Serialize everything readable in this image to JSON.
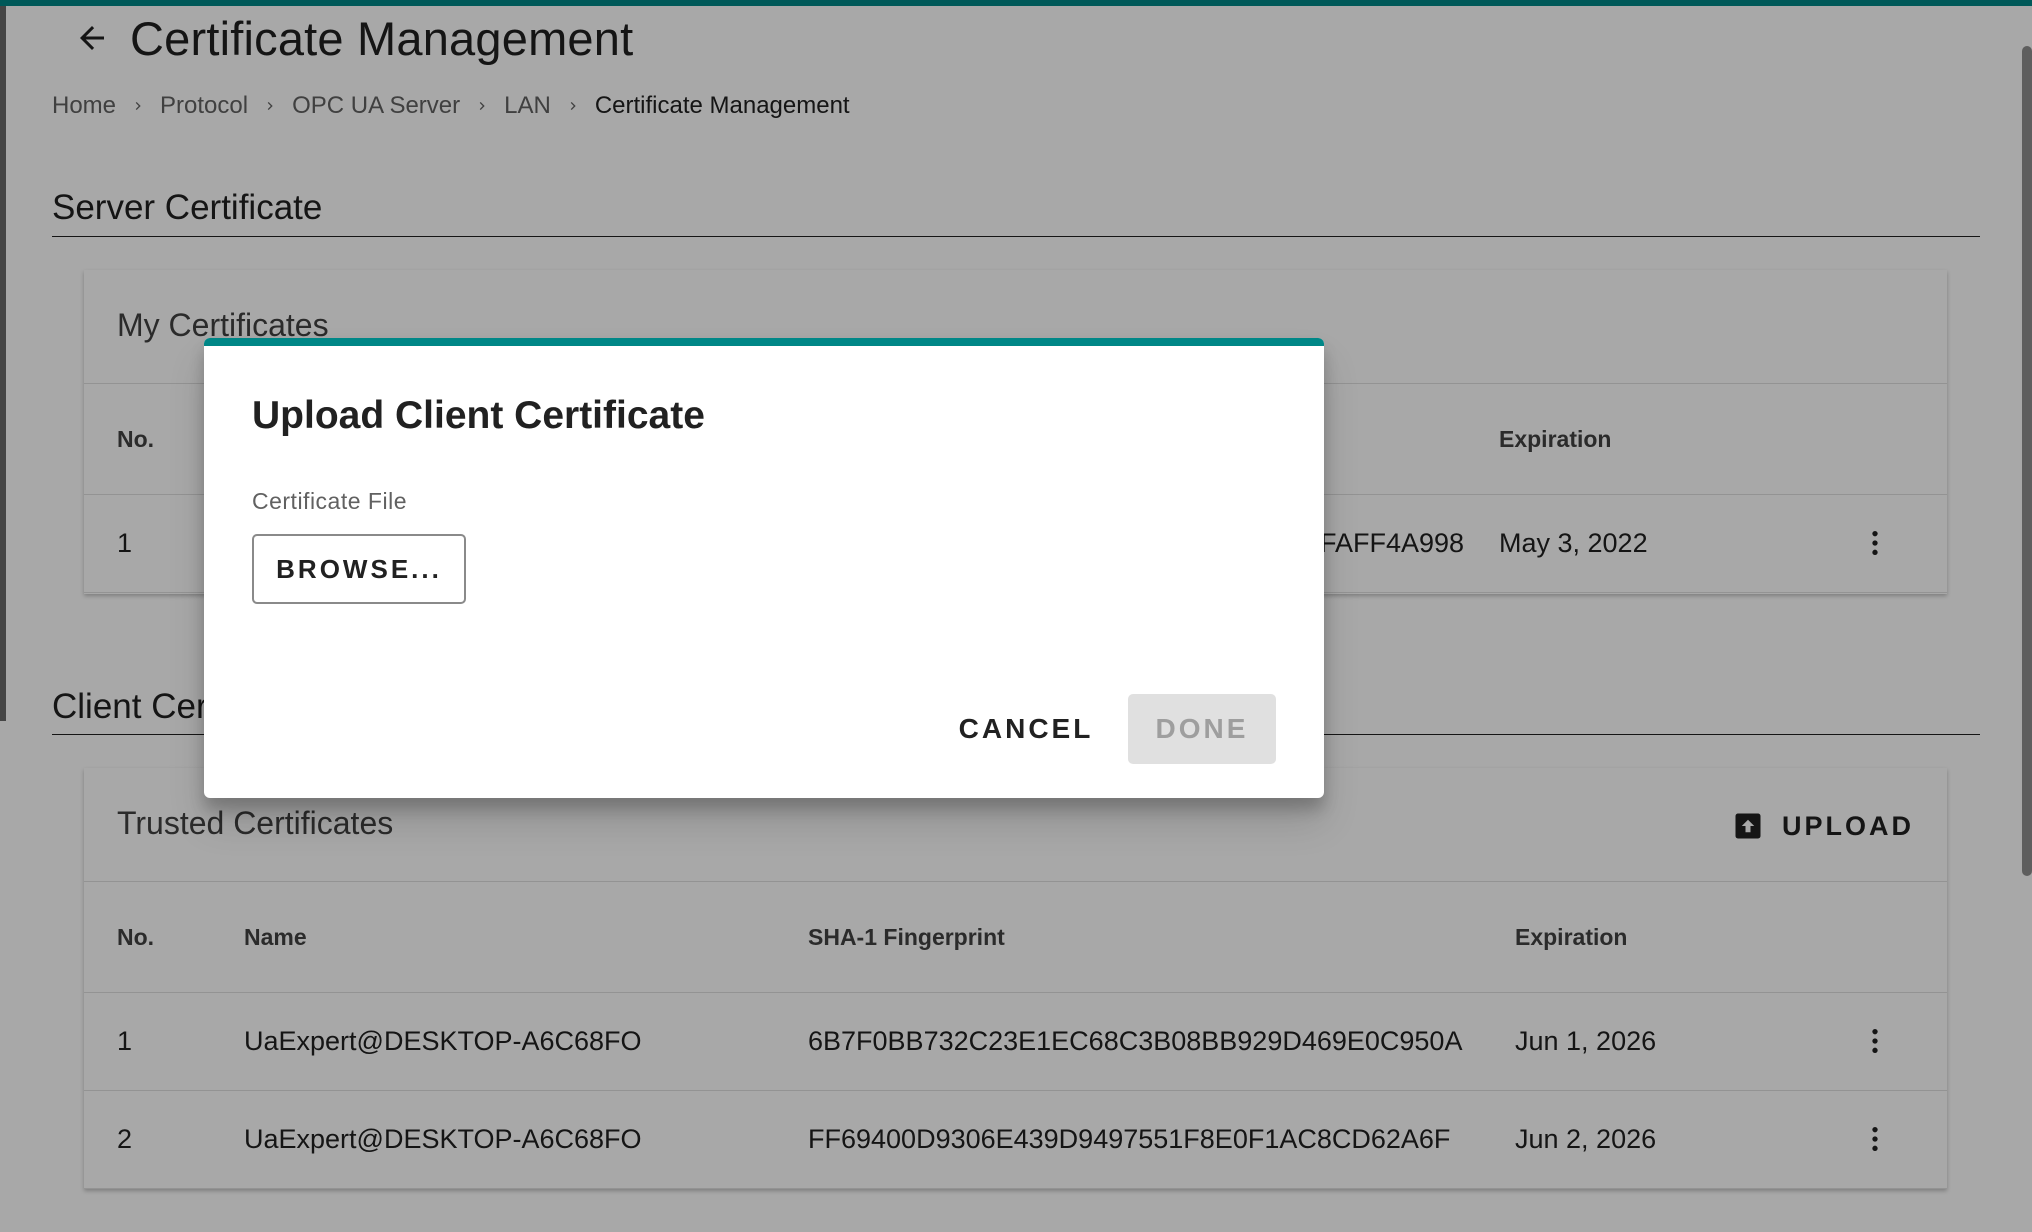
{
  "page": {
    "title": "Certificate Management",
    "breadcrumb": [
      "Home",
      "Protocol",
      "OPC UA Server",
      "LAN",
      "Certificate Management"
    ]
  },
  "server_section": {
    "title": "Server Certificate",
    "card_title": "My Certificates",
    "headers": {
      "no": "No.",
      "expiration": "Expiration"
    },
    "rows": [
      {
        "no": "1",
        "fingerprint_tail": "FAFF4A998",
        "expiration": "May 3, 2022"
      }
    ]
  },
  "client_section": {
    "title": "Client Certificate",
    "title_visible": "Client Cer",
    "card_title": "Trusted Certificates",
    "upload_label": "UPLOAD",
    "headers": {
      "no": "No.",
      "name": "Name",
      "fingerprint": "SHA-1 Fingerprint",
      "expiration": "Expiration"
    },
    "rows": [
      {
        "no": "1",
        "name": "UaExpert@DESKTOP-A6C68FO",
        "fingerprint": "6B7F0BB732C23E1EC68C3B08BB929D469E0C950A",
        "expiration": "Jun 1, 2026"
      },
      {
        "no": "2",
        "name": "UaExpert@DESKTOP-A6C68FO",
        "fingerprint": "FF69400D9306E439D9497551F8E0F1AC8CD62A6F",
        "expiration": "Jun 2, 2026"
      }
    ]
  },
  "dialog": {
    "title": "Upload Client Certificate",
    "field_label": "Certificate File",
    "browse_label": "BROWSE...",
    "cancel_label": "CANCEL",
    "done_label": "DONE",
    "done_enabled": false
  },
  "colors": {
    "accent": "#008787",
    "text": "#212121",
    "disabled_bg": "#e0e0e0",
    "disabled_text": "#9e9e9e"
  },
  "icons": {
    "back": "arrow-left-icon",
    "breadcrumb_separator": "chevron-right-icon",
    "row_menu": "more-vert-icon",
    "upload": "upload-icon"
  }
}
